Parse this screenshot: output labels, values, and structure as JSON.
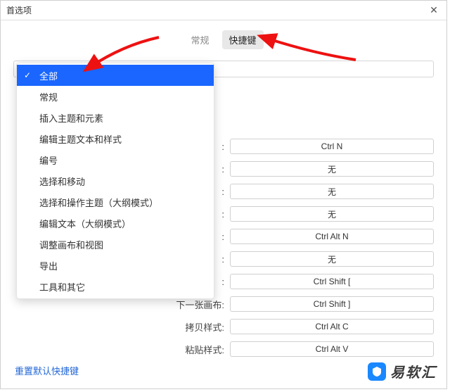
{
  "window": {
    "title": "首选项"
  },
  "tabs": {
    "general": "常规",
    "shortcuts": "快捷键",
    "active": 1
  },
  "search": {
    "placeholder": ""
  },
  "dropdown": {
    "items": [
      "全部",
      "常规",
      "插入主题和元素",
      "编辑主题文本和样式",
      "编号",
      "选择和移动",
      "选择和操作主题（大纲模式）",
      "编辑文本（大纲模式）",
      "调整画布和视图",
      "导出",
      "工具和其它"
    ],
    "selectedIndex": 0
  },
  "shortcuts": [
    {
      "label": ":",
      "value": "Ctrl N"
    },
    {
      "label": ":",
      "value": "无"
    },
    {
      "label": ":",
      "value": "无"
    },
    {
      "label": ":",
      "value": "无"
    },
    {
      "label": ":",
      "value": "Ctrl Alt N"
    },
    {
      "label": ":",
      "value": "无"
    },
    {
      "label": ":",
      "value": "Ctrl Shift ["
    },
    {
      "label": "下一张画布:",
      "value": "Ctrl Shift ]"
    },
    {
      "label": "拷贝样式:",
      "value": "Ctrl Alt C"
    },
    {
      "label": "粘贴样式:",
      "value": "Ctrl Alt V"
    }
  ],
  "reset": "重置默认快捷键",
  "brand": "易软汇"
}
